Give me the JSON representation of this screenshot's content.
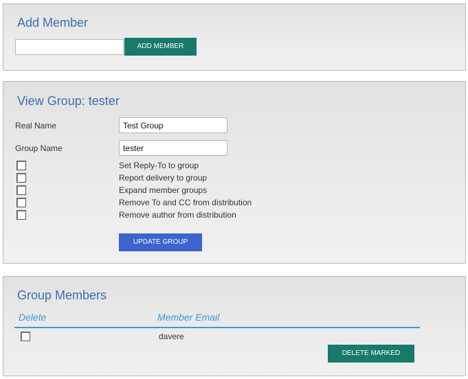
{
  "add_member": {
    "title": "Add Member",
    "input_value": "",
    "button_label": "ADD MEMBER"
  },
  "view_group": {
    "title": "View Group: tester",
    "real_name_label": "Real Name",
    "real_name_value": "Test Group",
    "group_name_label": "Group Name",
    "group_name_value": "tester",
    "options": [
      {
        "label": "Set Reply-To to group",
        "checked": false
      },
      {
        "label": "Report delivery to group",
        "checked": false
      },
      {
        "label": "Expand member groups",
        "checked": false
      },
      {
        "label": "Remove To and CC from distribution",
        "checked": false
      },
      {
        "label": "Remove author from distribution",
        "checked": false
      }
    ],
    "update_button_label": "UPDATE GROUP"
  },
  "group_members": {
    "title": "Group Members",
    "columns": [
      "Delete",
      "Member Email"
    ],
    "rows": [
      {
        "checked": false,
        "email": "davere"
      }
    ],
    "delete_button_label": "DELETE MARKED"
  },
  "colors": {
    "title_blue": "#3a6fb0",
    "header_blue": "#3a9ad6",
    "teal_button": "#177a6b",
    "blue_button": "#3d63cc"
  }
}
